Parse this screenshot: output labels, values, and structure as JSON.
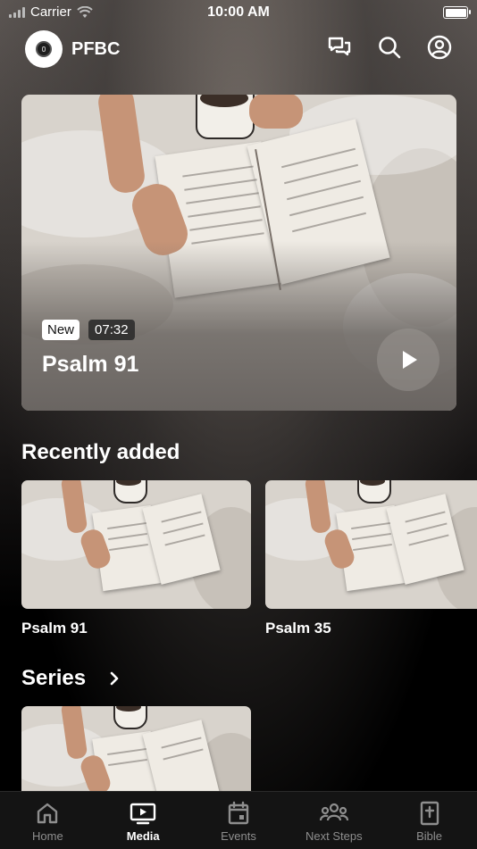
{
  "status_bar": {
    "carrier": "Carrier",
    "time": "10:00 AM"
  },
  "header": {
    "brand": "PFBC",
    "icons": [
      "chat-icon",
      "search-icon",
      "account-icon"
    ]
  },
  "hero": {
    "badge": "New",
    "duration": "07:32",
    "title": "Psalm 91"
  },
  "recently_added": {
    "title": "Recently added",
    "items": [
      {
        "title": "Psalm 91"
      },
      {
        "title": "Psalm 35"
      }
    ]
  },
  "series": {
    "title": "Series"
  },
  "tabbar": {
    "active": "Media",
    "tabs": [
      {
        "label": "Home",
        "icon": "home-icon"
      },
      {
        "label": "Media",
        "icon": "media-icon"
      },
      {
        "label": "Events",
        "icon": "calendar-icon"
      },
      {
        "label": "Next Steps",
        "icon": "people-icon"
      },
      {
        "label": "Bible",
        "icon": "bible-icon"
      }
    ]
  }
}
